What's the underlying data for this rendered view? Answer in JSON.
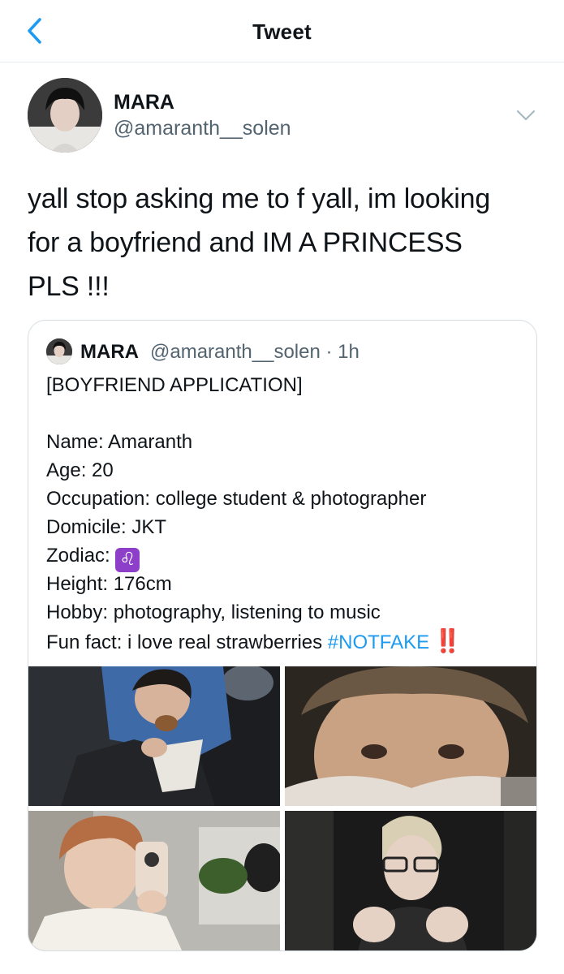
{
  "header": {
    "title": "Tweet",
    "back_icon": "chevron-left-icon"
  },
  "author": {
    "name": "MARA",
    "handle": "@amaranth__solen"
  },
  "tweet": {
    "lines": [
      "yall stop asking me to f yall, im looking",
      "for a boyfriend and IM A PRINCESS",
      "PLS !!!"
    ]
  },
  "quote": {
    "name": "MARA",
    "handle_time": "@amaranth__solen · 1h",
    "title": "[BOYFRIEND APPLICATION]",
    "fields": {
      "name": "Name: Amaranth",
      "age": "Age: 20",
      "occupation": "Occupation: college student & photographer",
      "domicile": "Domicile: JKT",
      "zodiac_label": "Zodiac: ",
      "zodiac_emoji": "♌",
      "height": "Height: 176cm",
      "hobby": "Hobby: photography, listening to music",
      "funfact_prefix": "Fun fact: i love real strawberries ",
      "hashtag": "#NOTFAKE",
      "funfact_suffix": " ‼️"
    }
  },
  "colors": {
    "accent": "#1d9bf0",
    "secondary_text": "#536471",
    "border": "#d5dde3"
  }
}
